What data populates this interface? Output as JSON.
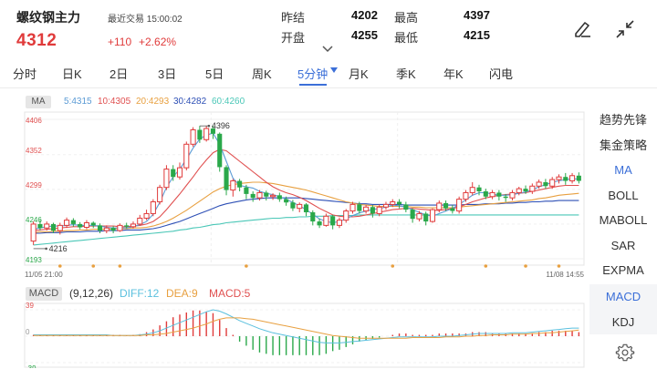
{
  "header": {
    "title": "螺纹钢主力",
    "trade_time": "最近交易 15:00:02",
    "price": "4312",
    "change": "+110",
    "change_pct": "+2.62%",
    "prev_close_label": "昨结",
    "prev_close": "4202",
    "open_label": "开盘",
    "open": "4255",
    "high_label": "最高",
    "high": "4397",
    "low_label": "最低",
    "low": "4215",
    "icons": [
      "edit-pen-icon",
      "collapse-arrows-icon",
      "chevron-down-icon"
    ]
  },
  "tabs": [
    {
      "label": "分时"
    },
    {
      "label": "日K"
    },
    {
      "label": "2日"
    },
    {
      "label": "3日"
    },
    {
      "label": "5日"
    },
    {
      "label": "周K"
    },
    {
      "label": "5分钟",
      "active": true
    },
    {
      "label": "月K"
    },
    {
      "label": "季K"
    },
    {
      "label": "年K"
    },
    {
      "label": "闪电"
    }
  ],
  "ma_legend": {
    "badge": "MA",
    "items": [
      {
        "label": "5:4315",
        "color": "#5b9bd5"
      },
      {
        "label": "10:4305",
        "color": "#e05050"
      },
      {
        "label": "20:4293",
        "color": "#e8a040"
      },
      {
        "label": "30:4282",
        "color": "#2d4fb5"
      },
      {
        "label": "60:4260",
        "color": "#4ac7b7"
      }
    ]
  },
  "macd_legend": {
    "badge": "MACD",
    "params": "(9,12,26)",
    "diff": "DIFF:12",
    "dea": "DEA:9",
    "macd": "MACD:5",
    "colors": {
      "params": "#333333",
      "diff": "#5bc0de",
      "dea": "#e8a040",
      "macd": "#e05050"
    }
  },
  "side_menu": [
    {
      "label": "趋势先锋"
    },
    {
      "label": "集金策略"
    },
    {
      "label": "MA",
      "active": true
    },
    {
      "label": "BOLL"
    },
    {
      "label": "MABOLL"
    },
    {
      "label": "SAR"
    },
    {
      "label": "EXPMA"
    },
    {
      "label": "MACD",
      "active": true,
      "boxed": true
    },
    {
      "label": "KDJ"
    }
  ],
  "side_icon": "settings-gear-icon",
  "colors": {
    "up": "#e03b3b",
    "down": "#2aa84a",
    "accent": "#3b6fd8"
  },
  "chart_data": {
    "type": "candlestick",
    "y_ticks": [
      "4406",
      "4352",
      "4299",
      "4246",
      "4193"
    ],
    "ylim": [
      4193,
      4406
    ],
    "x_labels": [
      "11/05 21:00",
      "11/08 14:55"
    ],
    "annotations": [
      {
        "label": "4396"
      },
      {
        "label": "4216"
      }
    ],
    "candles": [
      [
        4220,
        4246,
        4214,
        4250
      ],
      [
        4246,
        4240,
        4236,
        4252
      ],
      [
        4240,
        4246,
        4236,
        4250
      ],
      [
        4246,
        4236,
        4232,
        4248
      ],
      [
        4236,
        4244,
        4230,
        4248
      ],
      [
        4244,
        4252,
        4240,
        4256
      ],
      [
        4252,
        4246,
        4242,
        4255
      ],
      [
        4246,
        4241,
        4238,
        4249
      ],
      [
        4241,
        4248,
        4238,
        4252
      ],
      [
        4248,
        4244,
        4240,
        4250
      ],
      [
        4244,
        4236,
        4232,
        4247
      ],
      [
        4236,
        4240,
        4232,
        4244
      ],
      [
        4240,
        4236,
        4232,
        4243
      ],
      [
        4236,
        4244,
        4234,
        4247
      ],
      [
        4244,
        4242,
        4239,
        4248
      ],
      [
        4242,
        4246,
        4239,
        4250
      ],
      [
        4246,
        4255,
        4244,
        4260
      ],
      [
        4255,
        4262,
        4252,
        4268
      ],
      [
        4262,
        4280,
        4258,
        4284
      ],
      [
        4280,
        4302,
        4276,
        4306
      ],
      [
        4302,
        4330,
        4298,
        4336
      ],
      [
        4330,
        4318,
        4312,
        4336
      ],
      [
        4318,
        4332,
        4314,
        4340
      ],
      [
        4332,
        4368,
        4328,
        4372
      ],
      [
        4368,
        4390,
        4364,
        4394
      ],
      [
        4390,
        4375,
        4370,
        4396
      ],
      [
        4375,
        4392,
        4372,
        4396
      ],
      [
        4392,
        4384,
        4376,
        4396
      ],
      [
        4384,
        4333,
        4326,
        4386
      ],
      [
        4333,
        4298,
        4290,
        4336
      ],
      [
        4298,
        4312,
        4288,
        4315
      ],
      [
        4312,
        4302,
        4296,
        4315
      ],
      [
        4302,
        4292,
        4284,
        4306
      ],
      [
        4292,
        4286,
        4280,
        4296
      ],
      [
        4286,
        4294,
        4282,
        4298
      ],
      [
        4294,
        4288,
        4282,
        4297
      ],
      [
        4288,
        4290,
        4283,
        4293
      ],
      [
        4290,
        4284,
        4280,
        4294
      ],
      [
        4284,
        4279,
        4274,
        4288
      ],
      [
        4279,
        4270,
        4266,
        4283
      ],
      [
        4270,
        4276,
        4264,
        4279
      ],
      [
        4276,
        4264,
        4258,
        4278
      ],
      [
        4264,
        4250,
        4244,
        4267
      ],
      [
        4250,
        4244,
        4240,
        4254
      ],
      [
        4244,
        4258,
        4242,
        4262
      ],
      [
        4258,
        4244,
        4238,
        4260
      ],
      [
        4244,
        4252,
        4240,
        4256
      ],
      [
        4252,
        4266,
        4248,
        4269
      ],
      [
        4266,
        4276,
        4262,
        4280
      ],
      [
        4276,
        4266,
        4262,
        4280
      ],
      [
        4266,
        4272,
        4262,
        4275
      ],
      [
        4272,
        4262,
        4256,
        4275
      ],
      [
        4262,
        4272,
        4258,
        4276
      ],
      [
        4272,
        4276,
        4268,
        4280
      ],
      [
        4276,
        4280,
        4272,
        4284
      ],
      [
        4280,
        4276,
        4270,
        4284
      ],
      [
        4276,
        4268,
        4264,
        4280
      ],
      [
        4268,
        4254,
        4248,
        4270
      ],
      [
        4254,
        4262,
        4250,
        4266
      ],
      [
        4262,
        4250,
        4244,
        4265
      ],
      [
        4250,
        4268,
        4248,
        4270
      ],
      [
        4268,
        4278,
        4264,
        4282
      ],
      [
        4278,
        4270,
        4266,
        4282
      ],
      [
        4270,
        4266,
        4262,
        4275
      ],
      [
        4266,
        4284,
        4262,
        4288
      ],
      [
        4284,
        4294,
        4280,
        4298
      ],
      [
        4294,
        4302,
        4290,
        4310
      ],
      [
        4302,
        4296,
        4290,
        4306
      ],
      [
        4296,
        4288,
        4284,
        4300
      ],
      [
        4288,
        4294,
        4284,
        4298
      ],
      [
        4294,
        4288,
        4282,
        4298
      ],
      [
        4288,
        4286,
        4280,
        4292
      ],
      [
        4286,
        4294,
        4282,
        4298
      ],
      [
        4294,
        4300,
        4290,
        4303
      ],
      [
        4300,
        4296,
        4292,
        4305
      ],
      [
        4296,
        4304,
        4292,
        4308
      ],
      [
        4304,
        4310,
        4300,
        4314
      ],
      [
        4310,
        4304,
        4300,
        4315
      ],
      [
        4304,
        4314,
        4300,
        4318
      ],
      [
        4314,
        4318,
        4308,
        4322
      ],
      [
        4318,
        4312,
        4306,
        4324
      ],
      [
        4312,
        4320,
        4308,
        4324
      ],
      [
        4320,
        4312,
        4308,
        4325
      ]
    ],
    "ma5": [
      4238,
      4240,
      4242,
      4243,
      4243,
      4244,
      4245,
      4244,
      4244,
      4244,
      4243,
      4241,
      4240,
      4240,
      4240,
      4242,
      4245,
      4250,
      4261,
      4279,
      4302,
      4318,
      4330,
      4345,
      4362,
      4376,
      4382,
      4385,
      4368,
      4342,
      4316,
      4305,
      4303,
      4301,
      4296,
      4293,
      4291,
      4288,
      4284,
      4279,
      4274,
      4268,
      4261,
      4254,
      4250,
      4248,
      4250,
      4254,
      4259,
      4263,
      4266,
      4268,
      4270,
      4272,
      4275,
      4274,
      4272,
      4268,
      4264,
      4260,
      4258,
      4262,
      4266,
      4270,
      4276,
      4283,
      4290,
      4294,
      4294,
      4292,
      4290,
      4290,
      4291,
      4293,
      4295,
      4298,
      4303,
      4306,
      4310,
      4312,
      4314,
      4315,
      4315
    ],
    "ma10": [
      4236,
      4237,
      4238,
      4239,
      4240,
      4241,
      4242,
      4242,
      4243,
      4243,
      4243,
      4243,
      4243,
      4242,
      4242,
      4243,
      4244,
      4246,
      4250,
      4257,
      4268,
      4280,
      4292,
      4305,
      4318,
      4332,
      4344,
      4355,
      4360,
      4358,
      4350,
      4342,
      4334,
      4326,
      4318,
      4310,
      4303,
      4298,
      4294,
      4291,
      4287,
      4282,
      4276,
      4270,
      4265,
      4260,
      4258,
      4257,
      4257,
      4258,
      4260,
      4262,
      4264,
      4266,
      4268,
      4269,
      4270,
      4270,
      4269,
      4268,
      4267,
      4267,
      4268,
      4270,
      4272,
      4276,
      4280,
      4283,
      4286,
      4288,
      4290,
      4291,
      4292,
      4293,
      4294,
      4296,
      4298,
      4300,
      4302,
      4304,
      4305,
      4305,
      4305
    ],
    "ma20": [
      4233,
      4234,
      4234,
      4235,
      4235,
      4236,
      4236,
      4237,
      4237,
      4238,
      4238,
      4238,
      4239,
      4239,
      4239,
      4240,
      4240,
      4241,
      4243,
      4246,
      4250,
      4255,
      4261,
      4267,
      4274,
      4281,
      4288,
      4295,
      4300,
      4304,
      4306,
      4308,
      4309,
      4310,
      4310,
      4309,
      4308,
      4306,
      4304,
      4302,
      4300,
      4298,
      4295,
      4292,
      4289,
      4286,
      4283,
      4280,
      4278,
      4276,
      4275,
      4274,
      4273,
      4273,
      4273,
      4273,
      4273,
      4272,
      4272,
      4271,
      4271,
      4271,
      4271,
      4271,
      4272,
      4273,
      4274,
      4275,
      4276,
      4277,
      4278,
      4279,
      4280,
      4281,
      4282,
      4283,
      4285,
      4286,
      4288,
      4290,
      4291,
      4292,
      4293
    ],
    "ma30": [
      4232,
      4232,
      4233,
      4233,
      4233,
      4234,
      4234,
      4234,
      4235,
      4235,
      4235,
      4236,
      4236,
      4236,
      4237,
      4237,
      4237,
      4238,
      4239,
      4241,
      4244,
      4247,
      4250,
      4254,
      4258,
      4262,
      4266,
      4270,
      4274,
      4277,
      4279,
      4281,
      4283,
      4284,
      4285,
      4286,
      4286,
      4286,
      4286,
      4286,
      4286,
      4285,
      4284,
      4283,
      4282,
      4281,
      4280,
      4279,
      4278,
      4277,
      4277,
      4276,
      4276,
      4276,
      4276,
      4276,
      4275,
      4275,
      4275,
      4275,
      4275,
      4275,
      4275,
      4275,
      4275,
      4276,
      4276,
      4276,
      4277,
      4277,
      4277,
      4278,
      4278,
      4279,
      4279,
      4280,
      4280,
      4281,
      4281,
      4282,
      4282,
      4282,
      4282
    ],
    "ma60": [
      4214,
      4215,
      4216,
      4217,
      4218,
      4219,
      4220,
      4221,
      4222,
      4223,
      4224,
      4225,
      4226,
      4227,
      4228,
      4229,
      4230,
      4231,
      4232,
      4233,
      4234,
      4235,
      4237,
      4238,
      4240,
      4241,
      4243,
      4245,
      4246,
      4248,
      4249,
      4250,
      4251,
      4252,
      4253,
      4254,
      4255,
      4255,
      4256,
      4256,
      4257,
      4257,
      4258,
      4258,
      4258,
      4259,
      4259,
      4259,
      4259,
      4260,
      4260,
      4260,
      4260,
      4260,
      4260,
      4260,
      4260,
      4260,
      4260,
      4260,
      4260,
      4260,
      4260,
      4260,
      4260,
      4260,
      4260,
      4260,
      4260,
      4260,
      4260,
      4260,
      4260,
      4260,
      4260,
      4260,
      4260,
      4260,
      4260,
      4260,
      4260,
      4260,
      4260
    ],
    "macd_ylim": [
      -39,
      39
    ],
    "macd_ticks": [
      "39",
      "0",
      "-39"
    ],
    "diff": [
      2,
      2,
      2,
      2,
      2,
      2,
      2,
      2,
      2,
      2,
      2,
      2,
      1,
      1,
      1,
      1,
      2,
      3,
      5,
      8,
      12,
      16,
      20,
      24,
      28,
      32,
      36,
      39,
      37,
      33,
      28,
      23,
      19,
      15,
      11,
      8,
      5,
      3,
      1,
      -1,
      -3,
      -5,
      -7,
      -9,
      -10,
      -10,
      -10,
      -9,
      -8,
      -7,
      -6,
      -5,
      -4,
      -3,
      -2,
      -1,
      -1,
      -1,
      -1,
      -1,
      -1,
      0,
      0,
      0,
      1,
      2,
      3,
      4,
      4,
      4,
      4,
      4,
      5,
      5,
      5,
      6,
      7,
      8,
      9,
      10,
      11,
      12,
      12
    ],
    "dea": [
      1,
      1,
      1,
      1,
      1,
      1,
      1,
      1,
      1,
      1,
      1,
      1,
      1,
      1,
      1,
      1,
      1,
      2,
      2,
      3,
      4,
      6,
      8,
      10,
      12,
      15,
      18,
      22,
      25,
      27,
      27,
      27,
      26,
      25,
      23,
      21,
      19,
      17,
      15,
      13,
      11,
      9,
      7,
      5,
      3,
      1,
      0,
      -1,
      -2,
      -3,
      -3,
      -3,
      -3,
      -3,
      -3,
      -3,
      -3,
      -2,
      -2,
      -2,
      -2,
      -2,
      -1,
      -1,
      -1,
      0,
      0,
      1,
      1,
      2,
      2,
      2,
      3,
      3,
      3,
      4,
      4,
      5,
      5,
      6,
      7,
      8,
      9
    ],
    "macd": [
      2,
      2,
      2,
      2,
      2,
      2,
      2,
      2,
      2,
      2,
      2,
      2,
      2,
      2,
      1,
      2,
      3,
      6,
      10,
      16,
      22,
      28,
      32,
      35,
      38,
      38,
      36,
      34,
      24,
      12,
      2,
      -8,
      -14,
      -20,
      -24,
      -26,
      -28,
      -28,
      -28,
      -28,
      -28,
      -28,
      -28,
      -28,
      -26,
      -22,
      -20,
      -16,
      -12,
      -8,
      -6,
      -4,
      -2,
      0,
      2,
      4,
      4,
      2,
      2,
      2,
      2,
      4,
      4,
      4,
      4,
      4,
      6,
      6,
      6,
      4,
      4,
      4,
      4,
      4,
      4,
      4,
      6,
      6,
      8,
      8,
      8,
      8,
      6
    ]
  }
}
